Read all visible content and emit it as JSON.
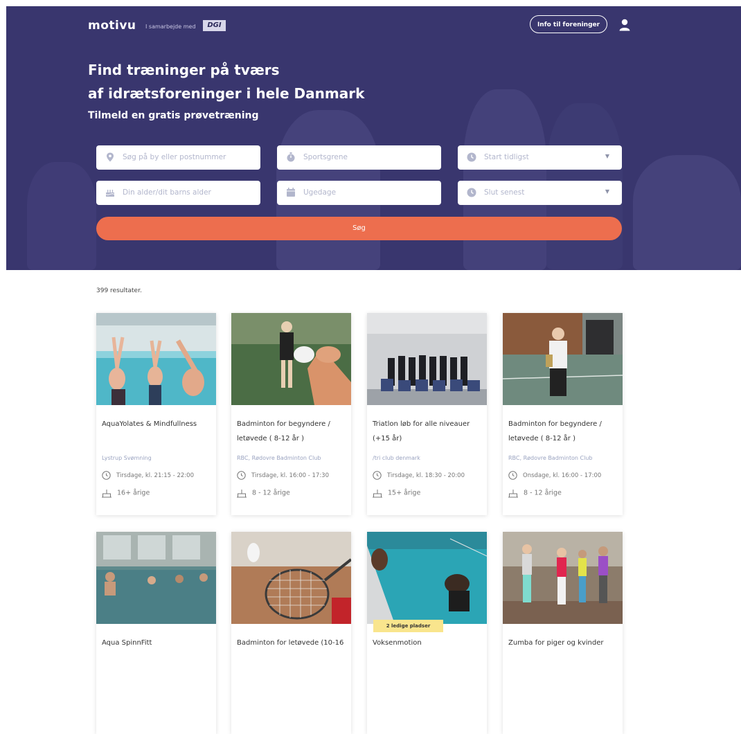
{
  "header": {
    "logo": "motivu",
    "partner_text": "I samarbejde med",
    "partner_logo": "DGI",
    "info_button": "Info til foreninger",
    "user_icon": "user-icon"
  },
  "hero": {
    "headline_1": "Find træninger på tværs",
    "headline_2": "af idrætsforeninger i hele Danmark",
    "subheadline": "Tilmeld en gratis prøvetræning"
  },
  "search": {
    "location_placeholder": "Søg på by eller postnummer",
    "sports_placeholder": "Sportsgrene",
    "start_placeholder": "Start tidligst",
    "age_placeholder": "Din alder/dit barns alder",
    "weekdays_placeholder": "Ugedage",
    "end_placeholder": "Slut senest",
    "button": "Søg"
  },
  "results": {
    "count_text": "399 resultater.",
    "cards": [
      {
        "title": "AquaYolates & Mindfullness",
        "club": "Lystrup Svømning",
        "time": "Tirsdage, kl. 21:15 - 22:00",
        "age": "16+ årige"
      },
      {
        "title": "Badminton for begyndere / letøvede ( 8-12 år )",
        "club": "RBC, Rødovre Badminton Club",
        "time": "Tirsdage, kl. 16:00 - 17:30",
        "age": "8 - 12 årige"
      },
      {
        "title": "Triatlon løb for alle niveauer (+15 år)",
        "club": "/tri club denmark",
        "time": "Tirsdage, kl. 18:30 - 20:00",
        "age": "15+ årige"
      },
      {
        "title": "Badminton for begyndere / letøvede ( 8-12 år )",
        "club": "RBC, Rødovre Badminton Club",
        "time": "Onsdage, kl. 16:00 - 17:00",
        "age": "8 - 12 årige"
      },
      {
        "title": "Aqua SpinnFitt"
      },
      {
        "title": "Badminton for letøvede (10-16"
      },
      {
        "title": "Voksenmotion",
        "badge": "2 ledige pladser"
      },
      {
        "title": "Zumba for piger og kvinder"
      }
    ]
  },
  "colors": {
    "hero_bg": "#39366e",
    "accent": "#ed6e4e",
    "badge": "#f9e58d",
    "club_text": "#9aa3c0"
  }
}
